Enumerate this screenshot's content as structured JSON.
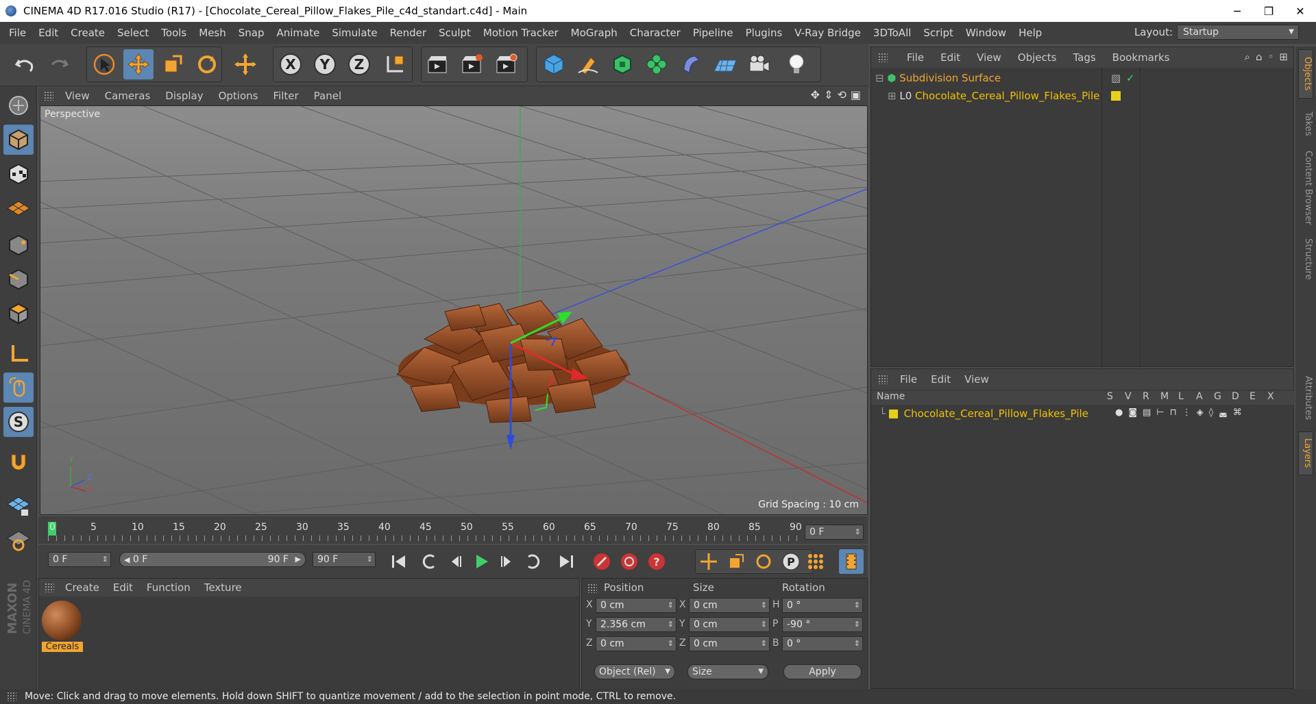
{
  "window": {
    "title": "CINEMA 4D R17.016 Studio (R17) - [Chocolate_Cereal_Pillow_Flakes_Pile_c4d_standart.c4d] - Main",
    "minimize": "─",
    "maximize": "❐",
    "close": "✕"
  },
  "menubar": {
    "items": [
      "File",
      "Edit",
      "Create",
      "Select",
      "Tools",
      "Mesh",
      "Snap",
      "Animate",
      "Simulate",
      "Render",
      "Sculpt",
      "Motion Tracker",
      "MoGraph",
      "Character",
      "Pipeline",
      "Plugins",
      "V-Ray Bridge",
      "3DToAll",
      "Script",
      "Window",
      "Help"
    ],
    "layout_label": "Layout:",
    "layout_value": "Startup"
  },
  "viewport": {
    "menu": [
      "View",
      "Cameras",
      "Display",
      "Options",
      "Filter",
      "Panel"
    ],
    "label": "Perspective",
    "grid_spacing": "Grid Spacing : 10 cm",
    "axis_y": "Y",
    "axis_z": "Z",
    "axis_x": "X"
  },
  "timeline": {
    "ticks": [
      "0",
      "5",
      "10",
      "15",
      "20",
      "25",
      "30",
      "35",
      "40",
      "45",
      "50",
      "55",
      "60",
      "65",
      "70",
      "75",
      "80",
      "85",
      "90"
    ],
    "current_frame": "0 F"
  },
  "transport": {
    "start_frame": "0 F",
    "range_start": "0 F",
    "range_end": "90 F",
    "end_frame": "90 F"
  },
  "material_panel": {
    "menu": [
      "Create",
      "Edit",
      "Function",
      "Texture"
    ],
    "material_name": "Cereals"
  },
  "coordinates": {
    "headers": {
      "position": "Position",
      "size": "Size",
      "rotation": "Rotation"
    },
    "rows": [
      {
        "pl": "X",
        "pos": "0 cm",
        "sl": "X",
        "size": "0 cm",
        "rl": "H",
        "rot": "0 °"
      },
      {
        "pl": "Y",
        "pos": "2.356 cm",
        "sl": "Y",
        "size": "0 cm",
        "rl": "P",
        "rot": "-90 °"
      },
      {
        "pl": "Z",
        "pos": "0 cm",
        "sl": "Z",
        "size": "0 cm",
        "rl": "B",
        "rot": "0 °"
      }
    ],
    "mode": "Object (Rel)",
    "size_mode": "Size",
    "apply": "Apply"
  },
  "objects_panel": {
    "menu": [
      "File",
      "Edit",
      "View",
      "Objects",
      "Tags",
      "Bookmarks"
    ],
    "objects": [
      {
        "name": "Subdivision Surface",
        "color": "#f2a533"
      },
      {
        "name": "Chocolate_Cereal_Pillow_Flakes_Pile",
        "color": "#f2c200"
      }
    ]
  },
  "layers_panel": {
    "menu": [
      "File",
      "Edit",
      "View"
    ],
    "name_header": "Name",
    "columns": [
      "S",
      "V",
      "R",
      "M",
      "L",
      "A",
      "G",
      "D",
      "E",
      "X"
    ],
    "layer_name": "Chocolate_Cereal_Pillow_Flakes_Pile",
    "layer_color": "#e8cf1a"
  },
  "right_tabs": [
    "Objects",
    "Takes",
    "Content Browser",
    "Structure",
    "Attributes",
    "Layers"
  ],
  "maxon_logo": "MAXON CINEMA 4D",
  "status": "Move: Click and drag to move elements. Hold down SHIFT to quantize movement / add to the selection in point mode, CTRL to remove."
}
